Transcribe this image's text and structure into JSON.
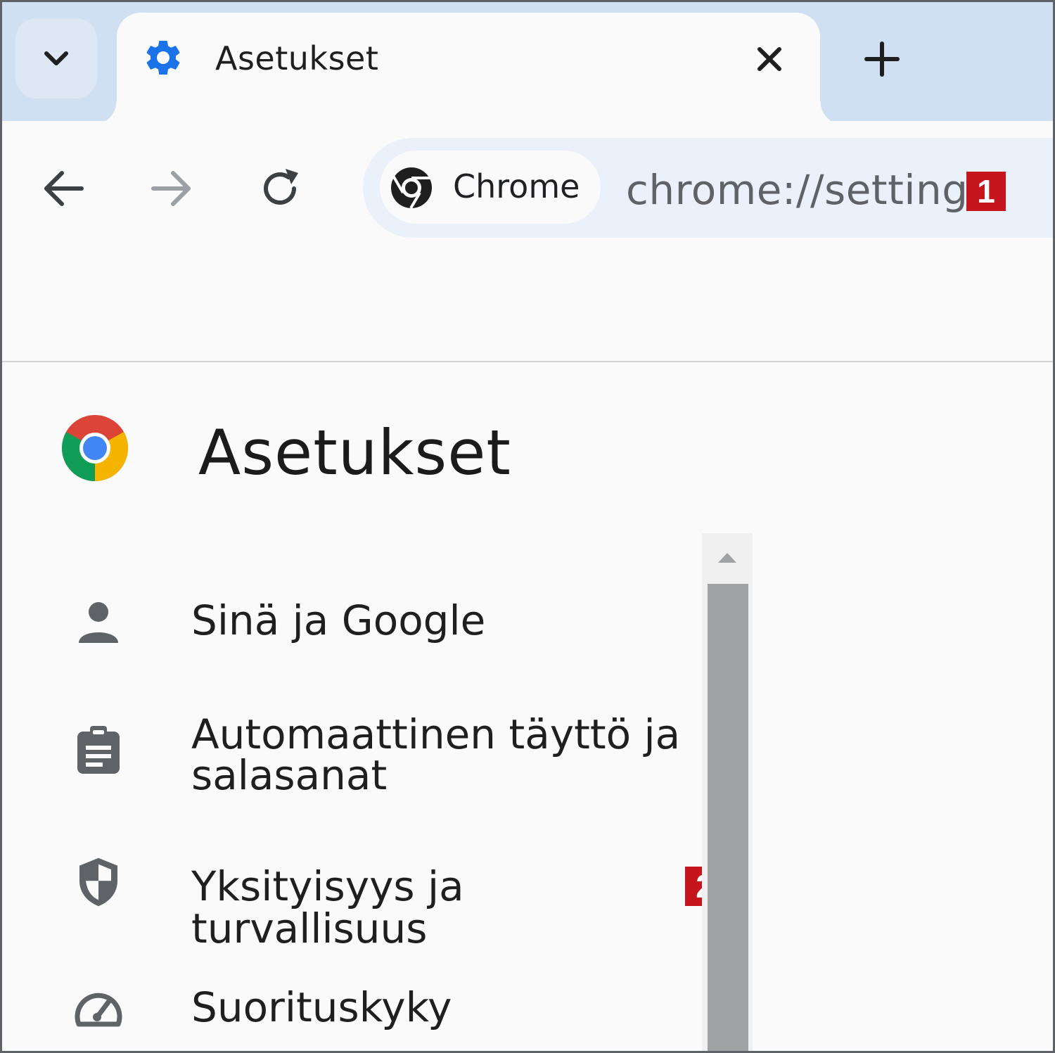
{
  "tab": {
    "title": "Asetukset",
    "icon": "gear-icon",
    "icon_color": "#1a73e8"
  },
  "toolbar": {
    "chip_label": "Chrome",
    "url": "chrome://settings",
    "url_marker": "1"
  },
  "header": {
    "title": "Asetukset"
  },
  "sidebar": {
    "items": [
      {
        "label": "Sinä ja Google",
        "icon": "person-icon"
      },
      {
        "label_line1": "Automaattinen täyttö ja",
        "label_line2": "salasanat",
        "icon": "clipboard-icon"
      },
      {
        "label": "Yksityisyys ja turvallisuus",
        "icon": "shield-icon",
        "marker": "2"
      },
      {
        "label": "Suorituskyky",
        "icon": "speedometer-icon"
      }
    ]
  },
  "colors": {
    "tabstrip": "#cfe0f3",
    "omnibox": "#eaf1fb",
    "marker": "#c4161c",
    "scroll_thumb": "#a0a2a3"
  }
}
